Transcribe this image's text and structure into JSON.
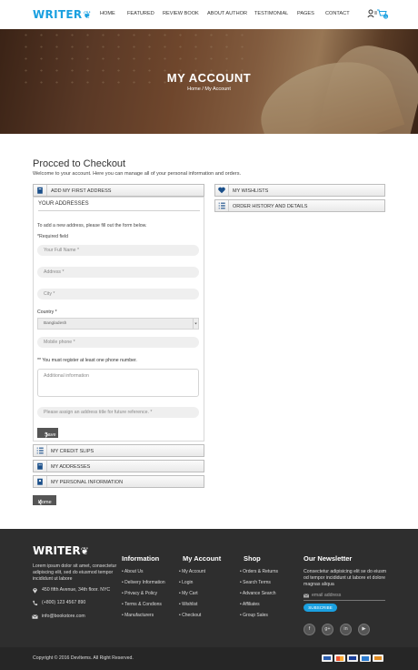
{
  "header": {
    "logo_text": "WRITER",
    "nav": [
      "HOME",
      "FEATURED",
      "REVIEW BOOK",
      "ABOUT AUTHOR",
      "TESTIMONIAL",
      "PAGES",
      "CONTACT"
    ],
    "cart_count": "0"
  },
  "hero": {
    "title": "MY ACCOUNT",
    "breadcrumb": "Home / My Account"
  },
  "main": {
    "title": "Procced to Checkout",
    "welcome": "Welcome to your account. Here you can manage all of your personal information and orders.",
    "add_address_label": "ADD MY FIRST ADDRESS",
    "your_addresses_label": "YOUR ADDRESSES",
    "instructions": "To add a new address, please fill out the form below.",
    "required_note": "*Required field",
    "placeholders": {
      "full_name": "Your Full Name *",
      "address": "Address *",
      "city": "City *",
      "mobile": "Mobile phone *",
      "additional": "Additional information",
      "address_title": "Please assign an address title for future reference. *"
    },
    "country_label": "Country *",
    "country_value": "Bangladesh",
    "phone_note": "** You must register at least one phone number.",
    "save_label": "Save",
    "credit_slips_label": "MY CREDIT SLIPS",
    "my_addresses_label": "MY ADDRESSES",
    "personal_info_label": "MY PERSONAL INFORMATION",
    "wishlists_label": "MY WISHLISTS",
    "order_history_label": "ORDER HISTORY AND DETAILS",
    "home_button_label": "Home"
  },
  "footer": {
    "logo_text": "WRITER",
    "about": "Lorem ipsum dolor sit amet, consectetur adipiscing elit, sed do eiusmod tempor incididunt ut labore",
    "address": "450 fifth Avenue, 34th floor. NYC",
    "phone": "(+800) 123 4567 890",
    "email": "info@bookstore.com",
    "columns": [
      {
        "title": "Information",
        "links": [
          "About Us",
          "Delivery Information",
          "Privacy & Policy",
          "Terms & Condions",
          "Manufacturers"
        ]
      },
      {
        "title": "My Account",
        "links": [
          "My Account",
          "Login",
          "My Cart",
          "Wishlist",
          "Checkout"
        ]
      },
      {
        "title": "Shop",
        "links": [
          "Orders & Returns",
          "Search Terms",
          "Advance Search",
          "Affiliates",
          "Group Sales"
        ]
      }
    ],
    "newsletter_title": "Our Newsletter",
    "newsletter_text": "Consectetur adipisicing elit se do eiusm od tempor incididunt ut labore et dolore magnas aliqua",
    "email_placeholder": "email address",
    "subscribe_label": "SUBSCRIBE",
    "social": [
      "f",
      "g+",
      "in",
      "▶"
    ],
    "copyright": "Copyright © 2016 DevItems. All Right Reserved."
  },
  "colors": {
    "accent": "#1aa0e0",
    "footer_bg": "#2e2e2e",
    "bottom_bar_bg": "#262626"
  }
}
